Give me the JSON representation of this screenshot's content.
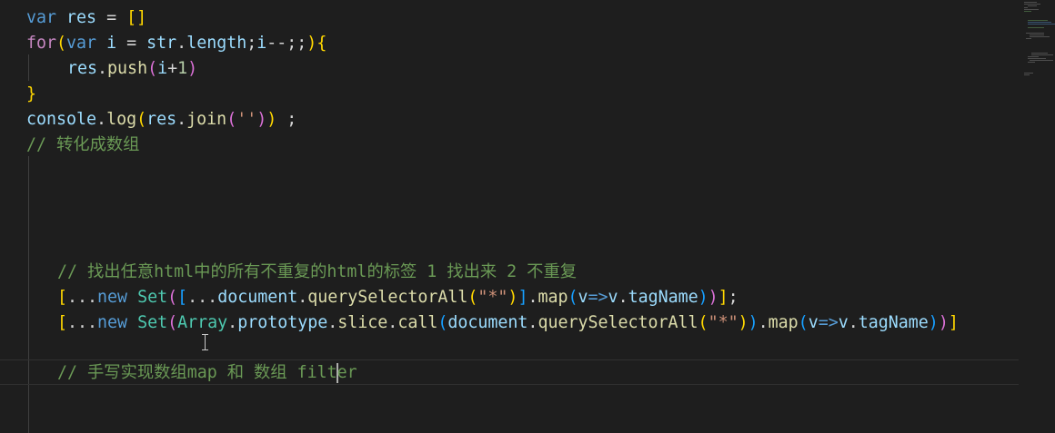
{
  "editor": {
    "lines": [
      [
        "var",
        " ",
        "res",
        " = ",
        "[]"
      ],
      [
        "for",
        "(",
        "var",
        " ",
        "i",
        " = ",
        "str",
        ".",
        "length",
        ";",
        "i",
        "--;;",
        ")",
        "{"
      ],
      [
        "res",
        ".",
        "push",
        "(",
        "i",
        "+",
        "1",
        ")"
      ],
      [
        "}"
      ],
      [
        "console",
        ".",
        "log",
        "(",
        "res",
        ".",
        "join",
        "(",
        "''",
        ")",
        ")",
        " ;"
      ],
      [
        "// 转化成数组"
      ],
      [
        "// 找出任意html中的所有不重复的html的标签 1 找出来 2 不重复"
      ],
      [
        "[",
        "...",
        "new",
        " ",
        "Set",
        "(",
        "[",
        "...",
        "document",
        ".",
        "querySelectorAll",
        "(",
        "\"*\"",
        ")",
        "]",
        ".",
        "map",
        "(",
        "v",
        "=>",
        "v",
        ".",
        "tagName",
        ")",
        ")",
        "]",
        ";"
      ],
      [
        "[",
        "...",
        "new",
        " ",
        "Set",
        "(",
        "Array",
        ".",
        "prototype",
        ".",
        "slice",
        ".",
        "call",
        "(",
        "document",
        ".",
        "querySelectorAll",
        "(",
        "\"*\"",
        ")",
        ")",
        ".",
        "map",
        "(",
        "v",
        "=>",
        "v",
        ".",
        "tagName",
        ")",
        ")",
        "]"
      ],
      [
        "// 手写实现数组map 和 数组 filt",
        "er"
      ]
    ]
  }
}
